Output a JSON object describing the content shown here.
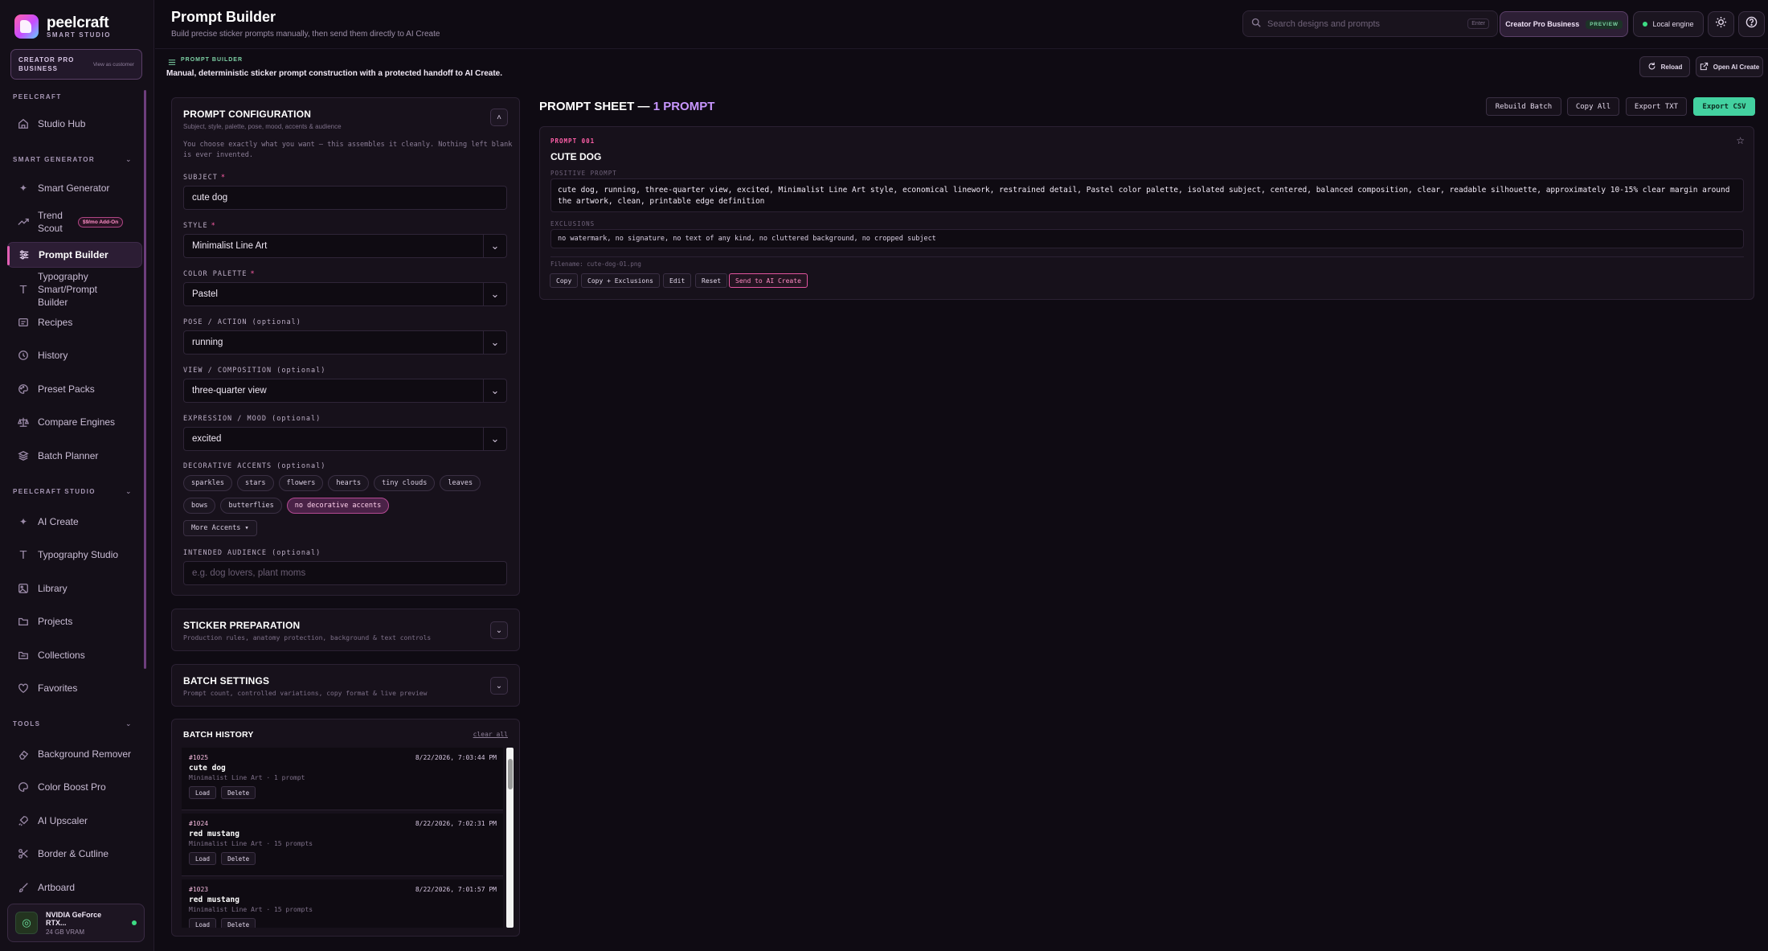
{
  "brand": {
    "name": "peelcraft",
    "sub": "SMART STUDIO"
  },
  "plan_card": {
    "title": "CREATOR PRO BUSINESS",
    "view_as": "View as customer"
  },
  "sidebar": {
    "section_peelcraft": "PEELCRAFT",
    "studio_hub": "Studio Hub",
    "section_smart": "SMART GENERATOR",
    "smart_generator": "Smart Generator",
    "trend_scout": "Trend Scout",
    "trend_addon": "$9/mo Add-On",
    "prompt_builder": "Prompt Builder",
    "typography_builder": "Typography Smart/Prompt Builder",
    "recipes": "Recipes",
    "history": "History",
    "preset_packs": "Preset Packs",
    "compare_engines": "Compare Engines",
    "batch_planner": "Batch Planner",
    "section_studio": "PEELCRAFT STUDIO",
    "ai_create": "AI Create",
    "typography_studio": "Typography Studio",
    "library": "Library",
    "projects": "Projects",
    "collections": "Collections",
    "favorites": "Favorites",
    "section_tools": "TOOLS",
    "background_remover": "Background Remover",
    "color_boost": "Color Boost Pro",
    "ai_upscaler": "AI Upscaler",
    "border_cutline": "Border & Cutline",
    "artboard": "Artboard"
  },
  "gpu": {
    "name": "NVIDIA GeForce RTX...",
    "vram": "24 GB VRAM"
  },
  "header": {
    "title": "Prompt Builder",
    "subtitle": "Build precise sticker prompts manually, then send them directly to AI Create",
    "search_placeholder": "Search designs and prompts",
    "search_kbd": "Enter",
    "plan": "Creator Pro Business",
    "plan_tag": "PREVIEW",
    "engine": "Local engine"
  },
  "subheader": {
    "label": "PROMPT BUILDER",
    "desc": "Manual, deterministic sticker prompt construction with a protected handoff to AI Create.",
    "reload": "Reload",
    "open_ai_create": "Open AI Create"
  },
  "config": {
    "title": "PROMPT CONFIGURATION",
    "subtitle": "Subject, style, palette, pose, mood, accents & audience",
    "intro": "You choose exactly what you want — this assembles it cleanly. Nothing left blank is ever invented.",
    "subject_label": "SUBJECT",
    "subject_value": "cute dog",
    "style_label": "STYLE",
    "style_value": "Minimalist Line Art",
    "palette_label": "COLOR PALETTE",
    "palette_value": "Pastel",
    "pose_label": "POSE / ACTION (optional)",
    "pose_value": "running",
    "view_label": "VIEW / COMPOSITION (optional)",
    "view_value": "three-quarter view",
    "mood_label": "EXPRESSION / MOOD (optional)",
    "mood_value": "excited",
    "accents_label": "DECORATIVE ACCENTS (optional)",
    "accents_row1": [
      "sparkles",
      "stars",
      "flowers",
      "hearts",
      "tiny clouds",
      "leaves"
    ],
    "accents_row2": [
      "bows",
      "butterflies",
      "no decorative accents"
    ],
    "more_accents": "More Accents ▾",
    "audience_label": "INTENDED AUDIENCE (optional)",
    "audience_placeholder": "e.g. dog lovers, plant moms",
    "required_mark": "*"
  },
  "sticker_prep": {
    "title": "STICKER PREPARATION",
    "subtitle": "Production rules, anatomy protection, background & text controls"
  },
  "batch_settings": {
    "title": "BATCH SETTINGS",
    "subtitle": "Prompt count, controlled variations, copy format & live preview"
  },
  "batch_history": {
    "title": "BATCH HISTORY",
    "clear": "clear all",
    "items": [
      {
        "num": "#1025",
        "date": "8/22/2026, 7:03:44 PM",
        "name": "cute dog",
        "meta": "Minimalist Line Art · 1 prompt",
        "load": "Load",
        "delete": "Delete"
      },
      {
        "num": "#1024",
        "date": "8/22/2026, 7:02:31 PM",
        "name": "red mustang",
        "meta": "Minimalist Line Art · 15 prompts",
        "load": "Load",
        "delete": "Delete"
      },
      {
        "num": "#1023",
        "date": "8/22/2026, 7:01:57 PM",
        "name": "red mustang",
        "meta": "Minimalist Line Art · 15 prompts",
        "load": "Load",
        "delete": "Delete"
      }
    ]
  },
  "sheet": {
    "title": "PROMPT SHEET —",
    "count": "1 PROMPT",
    "rebuild": "Rebuild Batch",
    "copy_all": "Copy All",
    "export_txt": "Export TXT",
    "export_csv": "Export CSV"
  },
  "prompt_card": {
    "num": "PROMPT 001",
    "name": "CUTE DOG",
    "positive_label": "POSITIVE PROMPT",
    "positive": "cute dog, running, three-quarter view, excited, Minimalist Line Art style, economical linework, restrained detail, Pastel color palette, isolated subject, centered, balanced composition, clear, readable silhouette, approximately 10-15% clear margin around the artwork, clean, printable edge definition",
    "exclusions_label": "EXCLUSIONS",
    "exclusions": "no watermark, no signature, no text of any kind, no cluttered background, no cropped subject",
    "filename": "Filename: cute-dog-01.png",
    "copy": "Copy",
    "copy_excl": "Copy + Exclusions",
    "edit": "Edit",
    "reset": "Reset",
    "send": "Send to AI Create"
  },
  "colors": {
    "accent": "#e2559f",
    "success": "#43d1a0",
    "bg": "#0f0b13"
  }
}
